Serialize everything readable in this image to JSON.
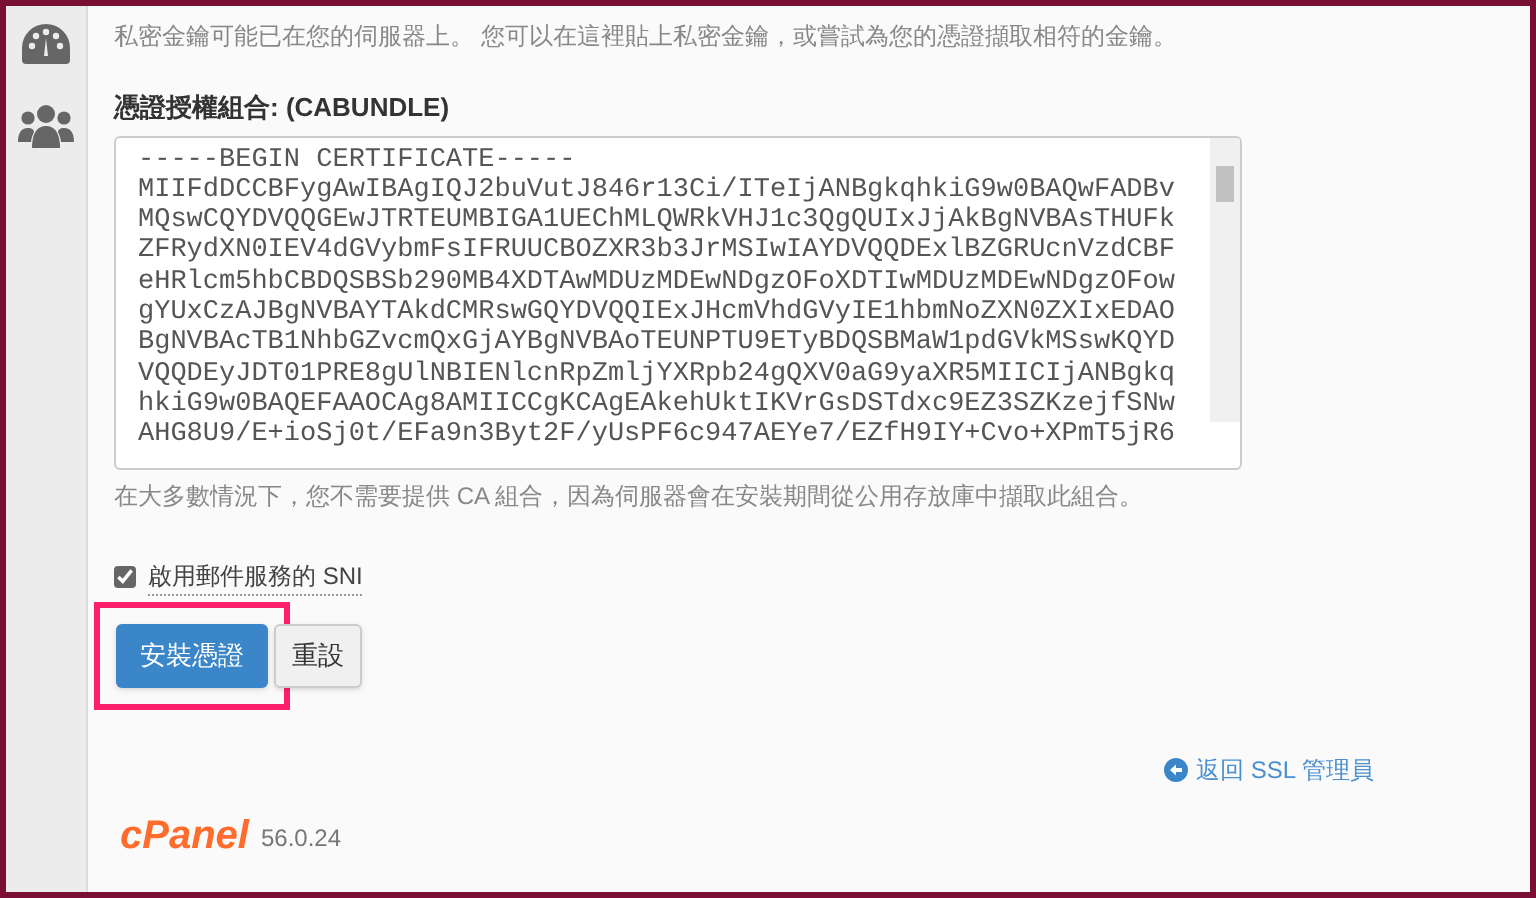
{
  "sidebar": {
    "items": [
      {
        "kind": "dashboard"
      },
      {
        "kind": "users"
      }
    ]
  },
  "intro": "私密金鑰可能已在您的伺服器上。 您可以在這裡貼上私密金鑰，或嘗試為您的憑證擷取相符的金鑰。",
  "cabundle": {
    "label": "憑證授權組合: (CABUNDLE)",
    "value": [
      "-----BEGIN CERTIFICATE-----",
      "MIIFdDCCBFygAwIBAgIQJ2buVutJ846r13Ci/ITeIjANBgkqhkiG9w0BAQwFADBv",
      "MQswCQYDVQQGEwJTRTEUMBIGA1UEChMLQWRkVHJ1c3QgQUIxJjAkBgNVBAsTHUFk",
      "ZFRydXN0IEV4dGVybmFsIFRUUCBOZXR3b3JrMSIwIAYDVQQDExlBZGRUcnVzdCBF",
      "eHRlcm5hbCBDQSBSb290MB4XDTAwMDUzMDEwNDgzOFoXDTIwMDUzMDEwNDgzOFow",
      "gYUxCzAJBgNVBAYTAkdCMRswGQYDVQQIExJHcmVhdGVyIE1hbmNoZXN0ZXIxEDAO",
      "BgNVBAcTB1NhbGZvcmQxGjAYBgNVBAoTEUNPTU9ETyBDQSBMaW1pdGVkMSswKQYD",
      "VQQDEyJDT01PRE8gUlNBIENlcnRpZmljYXRpb24gQXV0aG9yaXR5MIICIjANBgkq",
      "hkiG9w0BAQEFAAOCAg8AMIICCgKCAgEAkehUktIKVrGsDSTdxc9EZ3SZKzejfSNw",
      "AHG8U9/E+ioSj0t/EFa9n3Byt2F/yUsPF6c947AEYe7/EZfH9IY+Cvo+XPmT5jR6"
    ],
    "hint": "在大多數情況下，您不需要提供 CA 組合，因為伺服器會在安裝期間從公用存放庫中擷取此組合。"
  },
  "sni_checkbox": {
    "label": "啟用郵件服務的 SNI",
    "checked": true
  },
  "buttons": [
    {
      "label": "安裝憑證",
      "kind": "primary",
      "highlighted": true
    },
    {
      "label": "重設",
      "kind": "default",
      "highlighted": false
    }
  ],
  "back_link": "返回 SSL 管理員",
  "footer": {
    "logo": "cPanel",
    "version": "56.0.24"
  }
}
